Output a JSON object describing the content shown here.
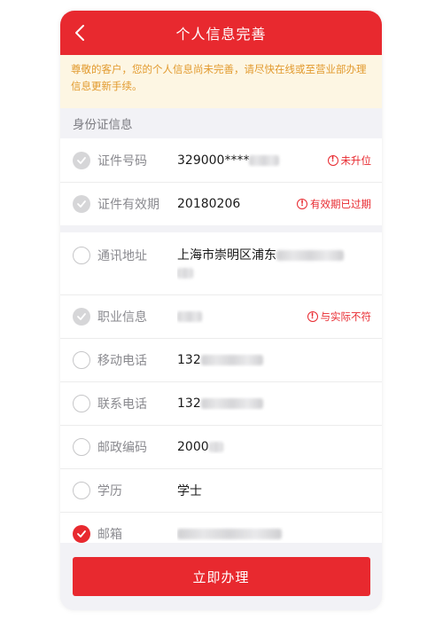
{
  "navbar": {
    "title": "个人信息完善"
  },
  "notice": {
    "text": "尊敬的客户，您的个人信息尚未完善，请尽快在线或至营业部办理信息更新手续。"
  },
  "section": {
    "title": "身份证信息"
  },
  "id_group": [
    {
      "label": "证件号码",
      "value": "329000****",
      "warning": "未升位",
      "status": "done"
    },
    {
      "label": "证件有效期",
      "value": "20180206",
      "warning": "有效期已过期",
      "status": "done"
    }
  ],
  "info_group": [
    {
      "label": "通讯地址",
      "value": "上海市崇明区浦东",
      "status": "empty"
    },
    {
      "label": "职业信息",
      "value": "",
      "warning": "与实际不符",
      "status": "done"
    },
    {
      "label": "移动电话",
      "value": "132",
      "status": "empty"
    },
    {
      "label": "联系电话",
      "value": "132",
      "status": "empty"
    },
    {
      "label": "邮政编码",
      "value": "2000",
      "status": "empty"
    },
    {
      "label": "学历",
      "value": "学士",
      "status": "empty"
    },
    {
      "label": "邮箱",
      "value": "",
      "status": "active"
    }
  ],
  "footer": {
    "submit_label": "立即办理"
  },
  "colors": {
    "brand_red": "#e8292f",
    "notice_bg": "#fdf6e3",
    "notice_text": "#e29a2e",
    "page_bg": "#f2f2f6"
  }
}
